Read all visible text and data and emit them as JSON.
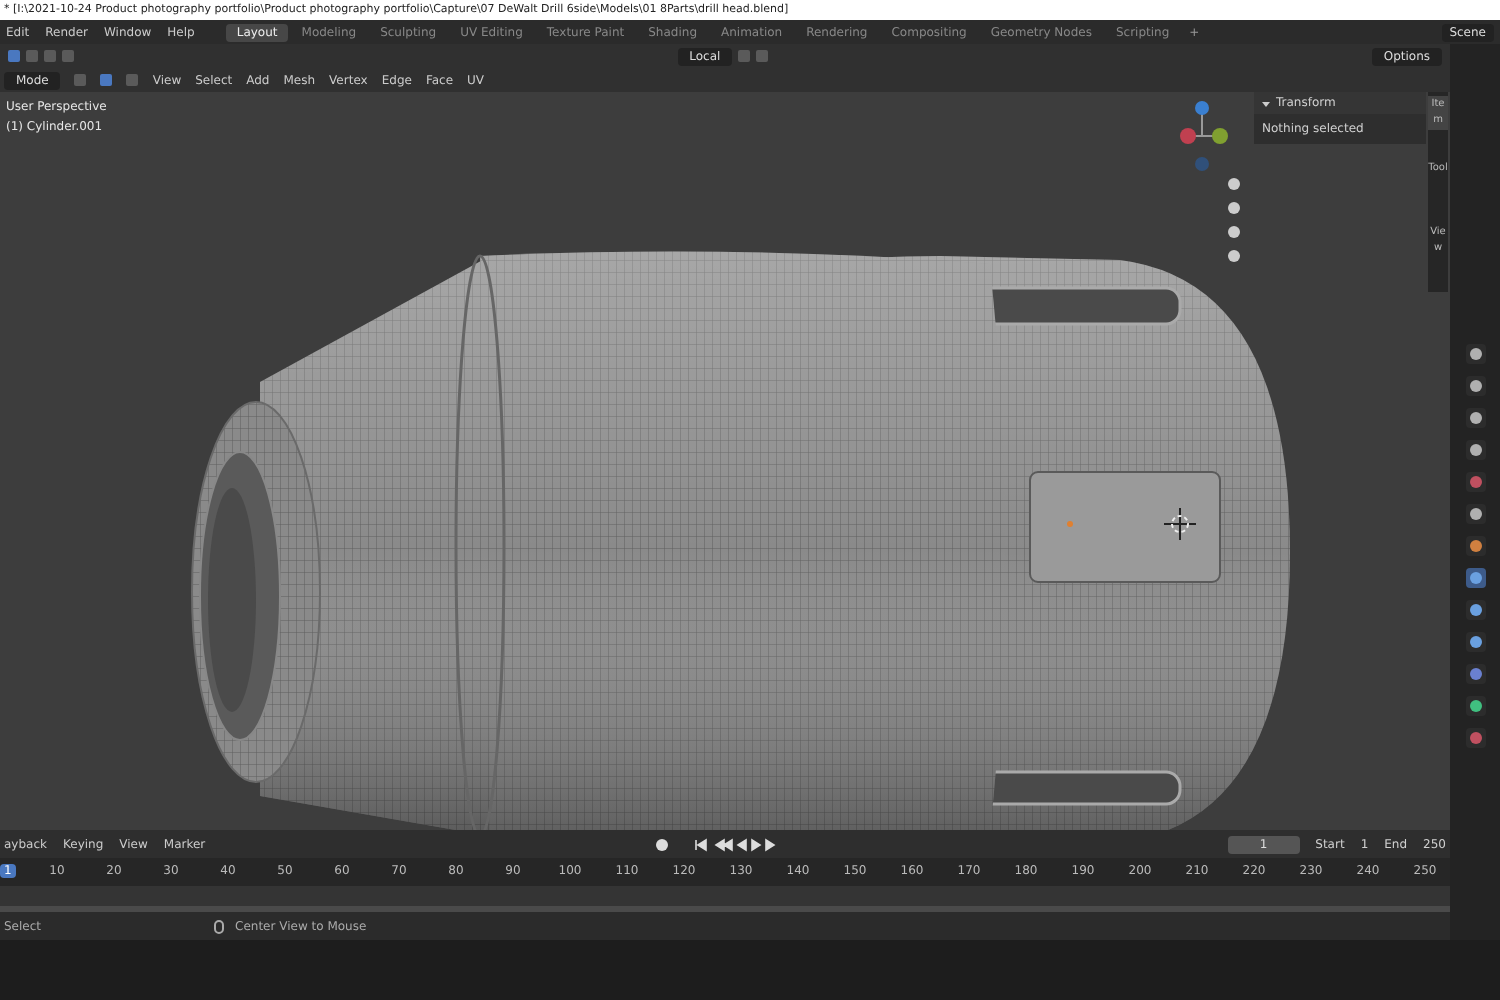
{
  "title_bar": {
    "title": "* [I:\\2021-10-24 Product photography portfolio\\Product photography portfolio\\Capture\\07 DeWalt Drill 6side\\Models\\01 8Parts\\drill head.blend]"
  },
  "menu": [
    "Edit",
    "Render",
    "Window",
    "Help"
  ],
  "workspace_tabs": [
    {
      "label": "Layout",
      "selected": true
    },
    {
      "label": "Modeling",
      "selected": false
    },
    {
      "label": "Sculpting",
      "selected": false
    },
    {
      "label": "UV Editing",
      "selected": false
    },
    {
      "label": "Texture Paint",
      "selected": false
    },
    {
      "label": "Shading",
      "selected": false
    },
    {
      "label": "Animation",
      "selected": false
    },
    {
      "label": "Rendering",
      "selected": false
    },
    {
      "label": "Compositing",
      "selected": false
    },
    {
      "label": "Geometry Nodes",
      "selected": false
    },
    {
      "label": "Scripting",
      "selected": false
    }
  ],
  "add_workspace": "+",
  "scene": "Scene",
  "tool_header": {
    "orientation": "Local",
    "options": "Options"
  },
  "viewport_header": {
    "mode": "Mode",
    "menus": [
      "View",
      "Select",
      "Add",
      "Mesh",
      "Vertex",
      "Edge",
      "Face",
      "UV"
    ]
  },
  "viewport": {
    "view_name": "User Perspective",
    "object": "(1) Cylinder.001"
  },
  "sidebar": {
    "panel_title": "Transform",
    "expanded": true,
    "message": "Nothing selected",
    "tabs": [
      {
        "label": "Item",
        "selected": true
      },
      {
        "label": "Tool",
        "selected": false
      },
      {
        "label": "View",
        "selected": false
      }
    ]
  },
  "property_tabs": [
    {
      "selected": false,
      "color": "#b0b0b0"
    },
    {
      "selected": false,
      "color": "#b0b0b0"
    },
    {
      "selected": false,
      "color": "#b0b0b0"
    },
    {
      "selected": false,
      "color": "#b0b0b0"
    },
    {
      "selected": false,
      "color": "#c05060"
    },
    {
      "selected": false,
      "color": "#b0b0b0"
    },
    {
      "selected": false,
      "color": "#d08040"
    },
    {
      "selected": true,
      "color": "#6aa0e0"
    },
    {
      "selected": false,
      "color": "#6aa0e0"
    },
    {
      "selected": false,
      "color": "#6aa0e0"
    },
    {
      "selected": false,
      "color": "#6a80d0"
    },
    {
      "selected": false,
      "color": "#40c080"
    },
    {
      "selected": false,
      "color": "#c05060"
    }
  ],
  "timeline": {
    "menus": [
      "ayback",
      "Keying",
      "View",
      "Marker"
    ],
    "current_frame": "1",
    "start_label": "Start",
    "start": "1",
    "end_label": "End",
    "end": "250",
    "ruler": [
      "1",
      "10",
      "20",
      "30",
      "40",
      "50",
      "60",
      "70",
      "80",
      "90",
      "100",
      "110",
      "120",
      "130",
      "140",
      "150",
      "160",
      "170",
      "180",
      "190",
      "200",
      "210",
      "220",
      "230",
      "240",
      "250"
    ]
  },
  "status_bar": [
    "Select",
    "Center View to Mouse"
  ]
}
